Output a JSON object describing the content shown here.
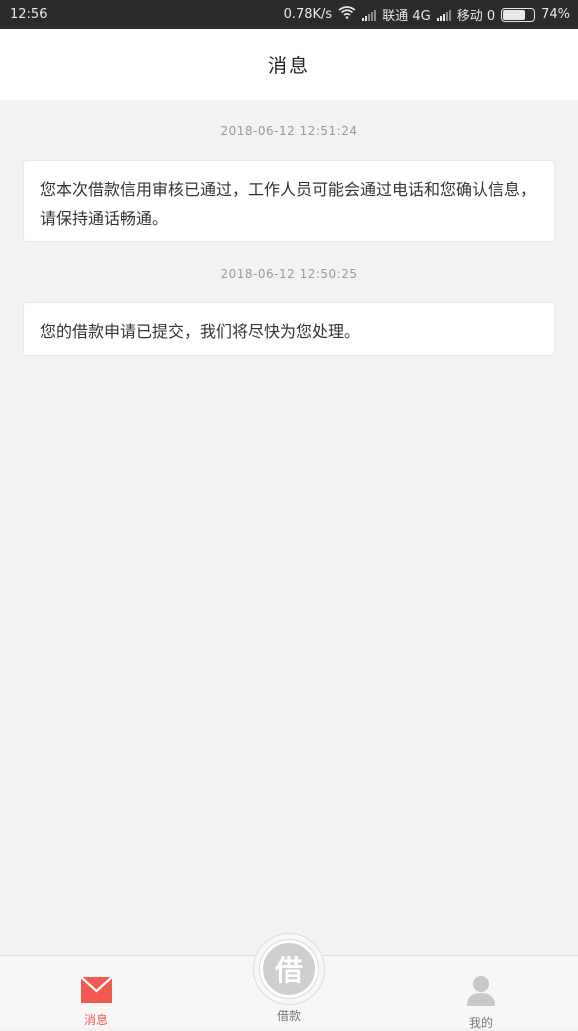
{
  "status_bar": {
    "time": "12:56",
    "network_speed": "0.78K/s",
    "carrier1": "联通 4G",
    "carrier2": "移动 0",
    "battery": "74%"
  },
  "header": {
    "title": "消息"
  },
  "messages": [
    {
      "timestamp": "2018-06-12 12:51:24",
      "text": "您本次借款信用审核已通过，工作人员可能会通过电话和您确认信息，请保持通话畅通。"
    },
    {
      "timestamp": "2018-06-12 12:50:25",
      "text": "您的借款申请已提交，我们将尽快为您处理。"
    }
  ],
  "tabbar": {
    "messages_label": "消息",
    "borrow_label": "借款",
    "borrow_glyph": "借",
    "mine_label": "我的"
  },
  "colors": {
    "accent": "#f05a50",
    "background": "#f2f2f4",
    "status_bar": "#2b2b2d"
  }
}
